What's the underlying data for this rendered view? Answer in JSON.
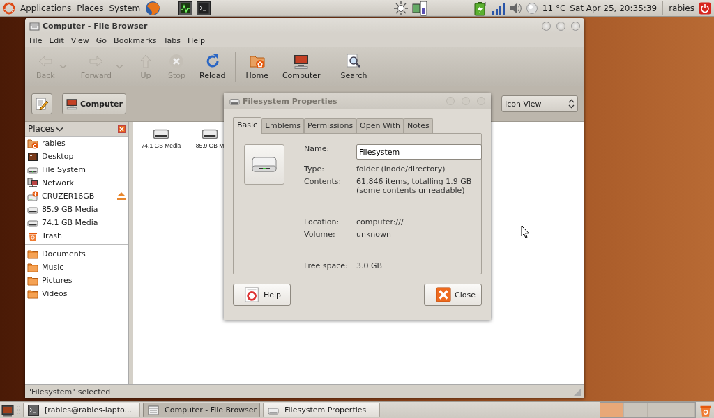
{
  "top_panel": {
    "menus": [
      "Applications",
      "Places",
      "System"
    ],
    "temperature": "11 °C",
    "clock": "Sat Apr 25, 20:35:39",
    "user": "rabies"
  },
  "file_browser": {
    "title": "Computer - File Browser",
    "menu": [
      "File",
      "Edit",
      "View",
      "Go",
      "Bookmarks",
      "Tabs",
      "Help"
    ],
    "toolbar_groups": [
      [
        {
          "label": "Back",
          "kind": "back",
          "disabled": true,
          "dropdown": true
        },
        {
          "label": "Forward",
          "kind": "forward",
          "disabled": true,
          "dropdown": true
        },
        {
          "label": "Up",
          "kind": "up",
          "disabled": true,
          "dropdown": false
        },
        {
          "label": "Stop",
          "kind": "stop",
          "disabled": true,
          "dropdown": false
        },
        {
          "label": "Reload",
          "kind": "reload",
          "disabled": false,
          "dropdown": false
        }
      ],
      [
        {
          "label": "Home",
          "kind": "home",
          "disabled": false,
          "dropdown": false
        },
        {
          "label": "Computer",
          "kind": "computer",
          "disabled": false,
          "dropdown": false
        }
      ],
      [
        {
          "label": "Search",
          "kind": "search",
          "disabled": false,
          "dropdown": false
        }
      ]
    ],
    "location_button": "Computer",
    "view_selector": "Icon View",
    "sidebar": {
      "title": "Places",
      "sections": [
        [
          {
            "label": "rabies",
            "kind": "home",
            "eject": false
          },
          {
            "label": "Desktop",
            "kind": "desktop",
            "eject": false
          },
          {
            "label": "File System",
            "kind": "drive",
            "eject": false
          },
          {
            "label": "Network",
            "kind": "network",
            "eject": false
          },
          {
            "label": "CRUZER16GB",
            "kind": "usb",
            "eject": true
          },
          {
            "label": "85.9 GB Media",
            "kind": "media",
            "eject": false
          },
          {
            "label": "74.1 GB Media",
            "kind": "media",
            "eject": false
          },
          {
            "label": "Trash",
            "kind": "trash",
            "eject": false
          }
        ],
        [
          {
            "label": "Documents",
            "kind": "folder",
            "eject": false
          },
          {
            "label": "Music",
            "kind": "folder",
            "eject": false
          },
          {
            "label": "Pictures",
            "kind": "folder",
            "eject": false
          },
          {
            "label": "Videos",
            "kind": "folder",
            "eject": false
          }
        ]
      ]
    },
    "files": [
      {
        "label": "74.1 GB Media"
      },
      {
        "label": "85.9 GB M"
      }
    ],
    "status": "\"Filesystem\" selected"
  },
  "dialog": {
    "title": "Filesystem Properties",
    "tabs": [
      {
        "label": "Basic",
        "selected": true
      },
      {
        "label": "Emblems",
        "selected": false
      },
      {
        "label": "Permissions",
        "selected": false
      },
      {
        "label": "Open With",
        "selected": false
      },
      {
        "label": "Notes",
        "selected": false
      }
    ],
    "name_label": "Name:",
    "name_value": "Filesystem",
    "field_groups": [
      [
        {
          "label": "Type:",
          "value": "folder (inode/directory)"
        },
        {
          "label": "Contents:",
          "value": "61,846 items, totalling 1.9 GB\n(some contents unreadable)"
        }
      ],
      [
        {
          "label": "Location:",
          "value": "computer:///"
        },
        {
          "label": "Volume:",
          "value": "unknown"
        }
      ],
      [
        {
          "label": "Free space:",
          "value": "3.0 GB"
        }
      ]
    ],
    "buttons": [
      {
        "label": "Help",
        "kind": "help"
      },
      {
        "label": "Close",
        "kind": "close"
      }
    ]
  },
  "taskbar": {
    "windows": [
      {
        "label": "[rabies@rabies-lapto...",
        "kind": "terminal",
        "selected": false
      },
      {
        "label": "Computer - File Browser",
        "kind": "files",
        "selected": true
      },
      {
        "label": "Filesystem Properties",
        "kind": "drive",
        "selected": false
      }
    ],
    "workspaces": [
      {
        "selected": true
      },
      {
        "selected": false
      },
      {
        "selected": false
      },
      {
        "selected": false
      }
    ]
  }
}
